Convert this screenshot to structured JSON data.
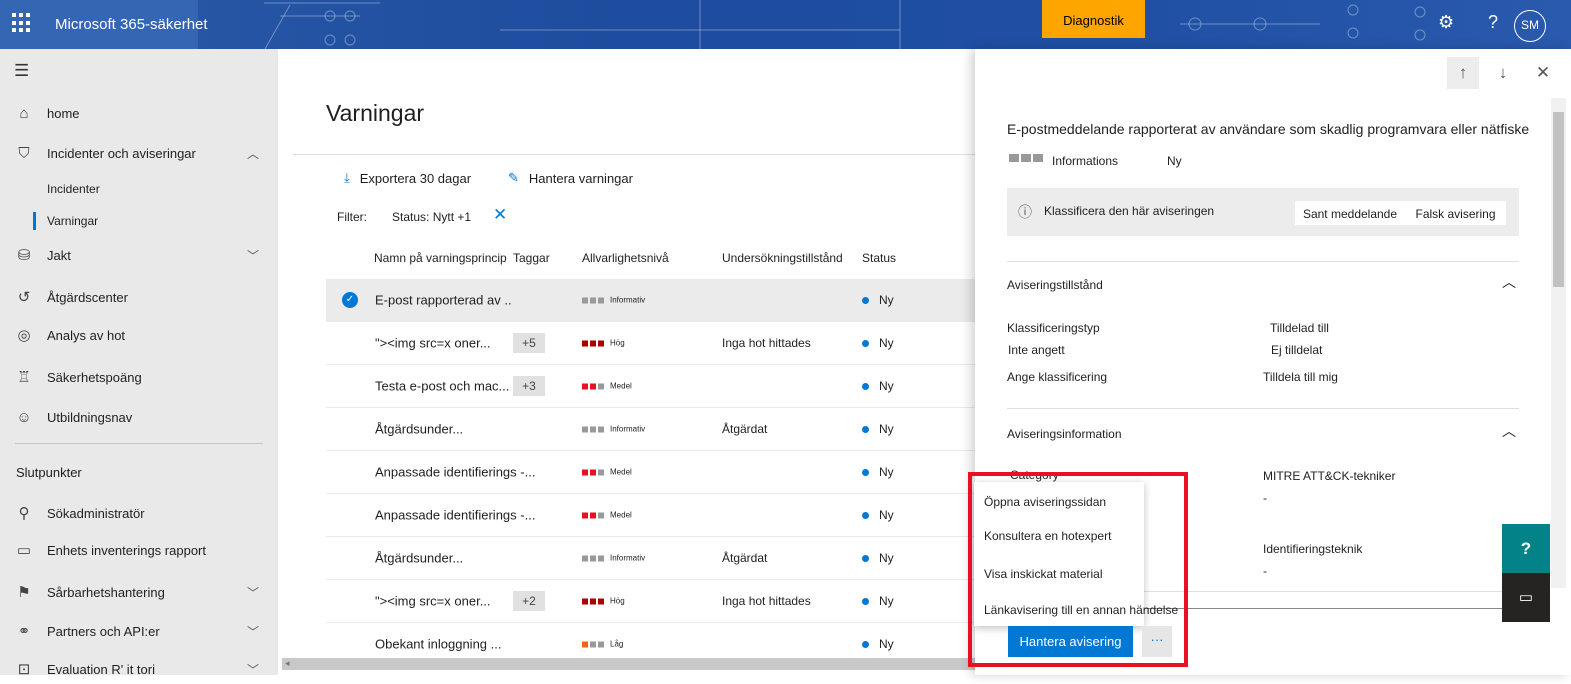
{
  "header": {
    "app_title": "Microsoft 365-säkerhet",
    "diagnostics": "Diagnostik",
    "avatar": "SM",
    "settings_icon": "gear-icon",
    "help_icon": "question-icon"
  },
  "sidebar": {
    "items": [
      {
        "label": "home",
        "icon": "home-icon"
      },
      {
        "label": "Incidenter och aviseringar",
        "icon": "shield-icon"
      },
      {
        "label": "Incidenter"
      },
      {
        "label": "Varningar"
      },
      {
        "label": "Jakt",
        "icon": "hunting-icon"
      },
      {
        "label": "Åtgärdscenter",
        "icon": "action-center-icon"
      },
      {
        "label": "Analys av hot",
        "icon": "threat-analytics-icon"
      },
      {
        "label": "Säkerhetspoäng",
        "icon": "trophy-icon"
      },
      {
        "label": "Utbildningsnav",
        "icon": "learning-icon"
      },
      {
        "label": "Sökadministratör",
        "icon": "search-icon"
      },
      {
        "label": "Enhets inventerings rapport",
        "icon": "laptop-icon"
      },
      {
        "label": "Sårbarhetshantering",
        "icon": "vulnerability-icon"
      },
      {
        "label": "Partners och API:er",
        "icon": "partners-icon"
      },
      {
        "label": "Evaluation R' it tori",
        "icon": "evaluation-icon"
      }
    ],
    "section_endpoints": "Slutpunkter"
  },
  "main": {
    "title": "Varningar",
    "export_label": "Exportera 30 dagar",
    "manage_label": "Hantera varningar",
    "filter_label": "Filter:",
    "filter_value": "Status: Nytt +1",
    "columns": [
      "Namn på varningsprincip",
      "Taggar",
      "Allvarlighetsnivå",
      "Undersökningstillstånd",
      "Status"
    ],
    "rows": [
      {
        "name": "E-post rapporterad av ..",
        "tags": "",
        "severity": "Informativ",
        "investigation": "",
        "status": "Ny"
      },
      {
        "name": "\"><img src=x oner...",
        "tags": "+5",
        "severity": "Hög",
        "investigation": "Inga hot hittades",
        "status": "Ny"
      },
      {
        "name": "Testa e-post och mac...",
        "tags": "+3",
        "severity": "Medel",
        "investigation": "",
        "status": "Ny"
      },
      {
        "name": "Åtgärdsunder...",
        "tags": "",
        "severity": "Informativ",
        "investigation": "Åtgärdat",
        "status": "Ny"
      },
      {
        "name": "Anpassade identifierings -...",
        "tags": "",
        "severity": "Medel",
        "investigation": "",
        "status": "Ny"
      },
      {
        "name": "Anpassade identifierings -...",
        "tags": "",
        "severity": "Medel",
        "investigation": "",
        "status": "Ny"
      },
      {
        "name": "Åtgärdsunder...",
        "tags": "",
        "severity": "Informativ",
        "investigation": "Åtgärdat",
        "status": "Ny"
      },
      {
        "name": "\"><img src=x oner...",
        "tags": "+2",
        "severity": "Hög",
        "investigation": "Inga hot hittades",
        "status": "Ny"
      },
      {
        "name": "Obekant inloggning ...",
        "tags": "",
        "severity": "Låg",
        "investigation": "",
        "status": "Ny"
      }
    ],
    "severity_colors": {
      "Informativ": [
        "#999999",
        "#999999",
        "#999999"
      ],
      "Hög": [
        "#a80000",
        "#a80000",
        "#a80000"
      ],
      "Medel": [
        "#e81123",
        "#e81123",
        "#999999"
      ],
      "Låg": [
        "#f7630c",
        "#999999",
        "#999999"
      ]
    }
  },
  "panel": {
    "title": "E-postmeddelande rapporterat av användare som skadlig programvara eller nätfiske",
    "severity": "Informations",
    "status": "Ny",
    "classify_text": "Klassificera den här aviseringen",
    "true_alert": "Sant meddelande",
    "false_alert": "Falsk avisering",
    "state_section": "Aviseringstillstånd",
    "classification_type_label": "Klassificeringstyp",
    "classification_type_value": "Inte angett",
    "set_classification": "Ange klassificering",
    "assigned_to_label": "Tilldelad till",
    "assigned_to_value": "Ej tilldelat",
    "assign_to_me": "Tilldela till mig",
    "info_section": "Aviseringsinformation",
    "category_label": "Category",
    "mitre_label": "MITRE ATT&CK-tekniker",
    "mitre_value": "-",
    "detection_label": "Identifieringsteknik",
    "detection_value": "-",
    "manage_button": "Hantera avisering",
    "more_button": "···",
    "menu": [
      "Öppna aviseringssidan",
      "Konsultera en hotexpert",
      "Visa inskickat material",
      "Länkavisering till en annan händelse"
    ]
  }
}
